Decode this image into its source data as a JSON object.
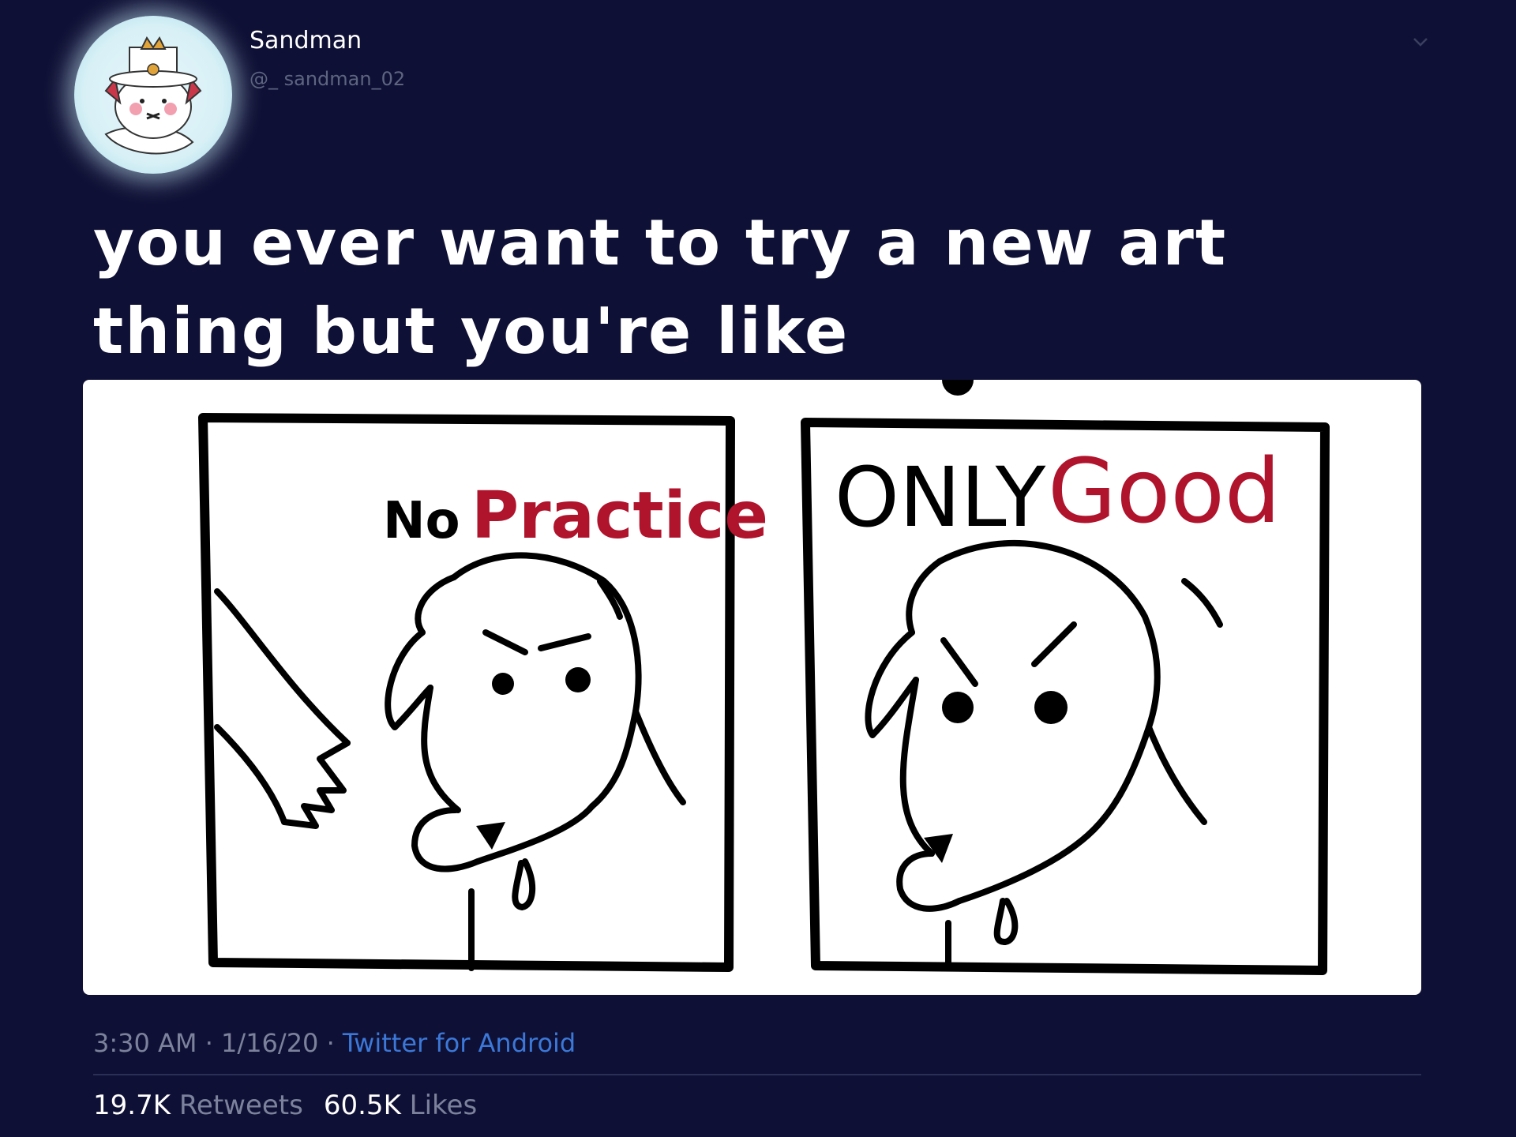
{
  "user": {
    "display_name": "Sandman",
    "handle": "@_ sandman_02",
    "avatar_icon": "avatar-image"
  },
  "tweet": {
    "text": "you ever want to try a new art thing but you're like",
    "time": "3:30 AM",
    "date": "1/16/20",
    "separator": " · ",
    "source": "Twitter for Android"
  },
  "comic": {
    "panel_left_word1": "No",
    "panel_left_word2": "Practice",
    "panel_right_word1": "ONLY",
    "panel_right_word2": "Good",
    "accent_color": "#b0132c"
  },
  "stats": {
    "retweets_count": "19.7K",
    "retweets_label": "Retweets",
    "likes_count": "60.5K",
    "likes_label": "Likes"
  },
  "colors": {
    "background": "#0f1035",
    "text": "#ffffff",
    "muted": "#7c829c",
    "link": "#3b78d8"
  }
}
